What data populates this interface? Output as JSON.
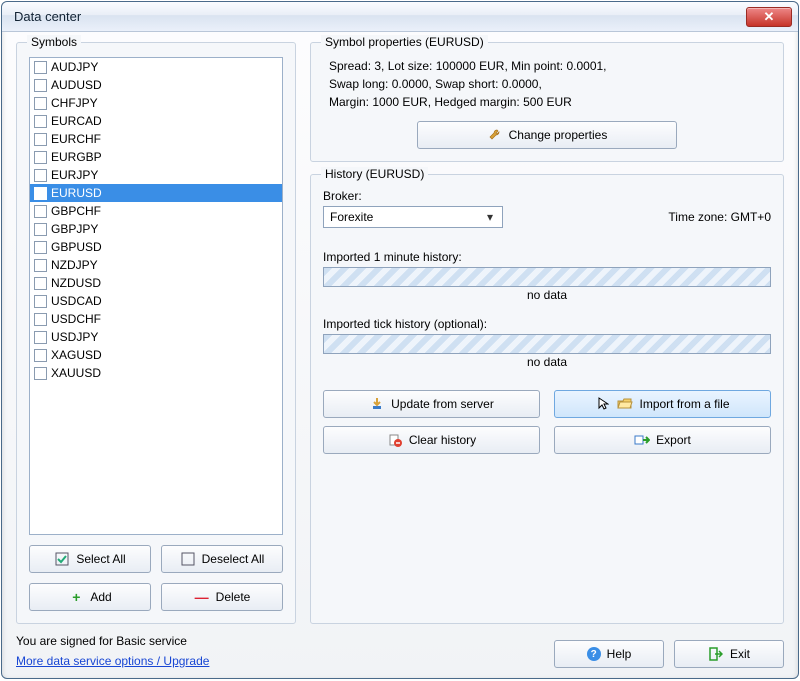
{
  "window": {
    "title": "Data center"
  },
  "symbols": {
    "legend": "Symbols",
    "items": [
      {
        "name": "AUDJPY",
        "selected": false
      },
      {
        "name": "AUDUSD",
        "selected": false
      },
      {
        "name": "CHFJPY",
        "selected": false
      },
      {
        "name": "EURCAD",
        "selected": false
      },
      {
        "name": "EURCHF",
        "selected": false
      },
      {
        "name": "EURGBP",
        "selected": false
      },
      {
        "name": "EURJPY",
        "selected": false
      },
      {
        "name": "EURUSD",
        "selected": true
      },
      {
        "name": "GBPCHF",
        "selected": false
      },
      {
        "name": "GBPJPY",
        "selected": false
      },
      {
        "name": "GBPUSD",
        "selected": false
      },
      {
        "name": "NZDJPY",
        "selected": false
      },
      {
        "name": "NZDUSD",
        "selected": false
      },
      {
        "name": "USDCAD",
        "selected": false
      },
      {
        "name": "USDCHF",
        "selected": false
      },
      {
        "name": "USDJPY",
        "selected": false
      },
      {
        "name": "XAGUSD",
        "selected": false
      },
      {
        "name": "XAUUSD",
        "selected": false
      }
    ],
    "select_all": "Select All",
    "deselect_all": "Deselect All",
    "add": "Add",
    "delete": "Delete"
  },
  "properties": {
    "legend": "Symbol properties (EURUSD)",
    "line1": "Spread: 3, Lot size: 100000 EUR, Min point: 0.0001,",
    "line2": "Swap long: 0.0000, Swap short: 0.0000,",
    "line3": "Margin: 1000 EUR, Hedged margin: 500 EUR",
    "change_btn": "Change properties"
  },
  "history": {
    "legend": "History (EURUSD)",
    "broker_label": "Broker:",
    "broker_value": "Forexite",
    "timezone": "Time zone: GMT+0",
    "minute_label": "Imported 1 minute history:",
    "minute_status": "no data",
    "tick_label": "Imported tick history (optional):",
    "tick_status": "no data",
    "update_btn": "Update from server",
    "import_btn": "Import from a file",
    "clear_btn": "Clear history",
    "export_btn": "Export"
  },
  "footer": {
    "signed": "You are signed for Basic service",
    "link": "More data service options / Upgrade",
    "help": "Help",
    "exit": "Exit"
  }
}
